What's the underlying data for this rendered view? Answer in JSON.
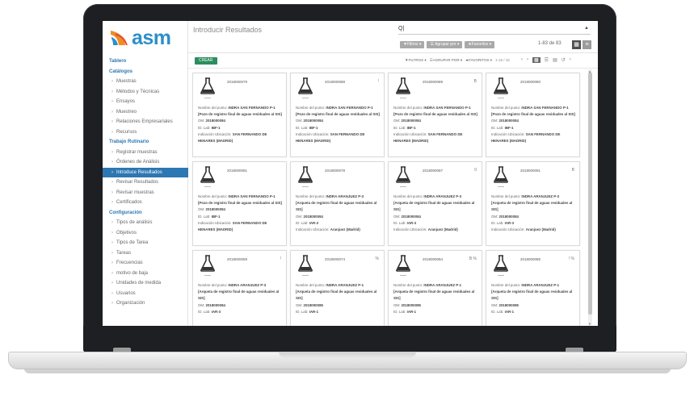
{
  "app": {
    "logo_text": "asm",
    "page_title": "Introducir Resultados",
    "brand_color": "#2d8fc8",
    "active_color": "#2d77b2",
    "create_color": "#2b8e5d"
  },
  "sidebar": {
    "items": [
      {
        "label": "Tablero",
        "type": "head"
      },
      {
        "label": "Catálogos",
        "type": "head"
      },
      {
        "label": "Muestras",
        "type": "sub"
      },
      {
        "label": "Métodos y Técnicas",
        "type": "sub"
      },
      {
        "label": "Ensayos",
        "type": "sub"
      },
      {
        "label": "Muestreo",
        "type": "sub"
      },
      {
        "label": "Relaciones Empresariales",
        "type": "sub"
      },
      {
        "label": "Recursos",
        "type": "sub"
      },
      {
        "label": "Trabajo Rutinario",
        "type": "head"
      },
      {
        "label": "Registrar muestras",
        "type": "sub"
      },
      {
        "label": "Órdenes de Análisis",
        "type": "sub"
      },
      {
        "label": "Introduce Resultados",
        "type": "active"
      },
      {
        "label": "Revisar Resultados",
        "type": "sub"
      },
      {
        "label": "Revisar muestras",
        "type": "sub"
      },
      {
        "label": "Certificados",
        "type": "sub"
      },
      {
        "label": "Configuración",
        "type": "head"
      },
      {
        "label": "Tipos de análisis",
        "type": "sub"
      },
      {
        "label": "Objetivos",
        "type": "sub"
      },
      {
        "label": "Tipos de Tarea",
        "type": "sub"
      },
      {
        "label": "Tareas",
        "type": "sub"
      },
      {
        "label": "Frecuencias",
        "type": "sub"
      },
      {
        "label": "motivo de baja",
        "type": "sub"
      },
      {
        "label": "Unidades de medida",
        "type": "sub"
      },
      {
        "label": "Usuarios",
        "type": "sub"
      },
      {
        "label": "Organización",
        "type": "sub"
      }
    ]
  },
  "topbar": {
    "search_value": "Q|",
    "filter_buttons": [
      "▼Filtros ▾",
      "☰ Agrupar por ▾",
      "★Favoritos ▾"
    ],
    "pager": "1-83 de 83"
  },
  "toolbar": {
    "create_label": "CREAR",
    "filters_label": "▼FILTROS ▾",
    "group_label": "☰AGRUPAR POR ▾",
    "fav_label": "★FAVORITOS ▾",
    "pager": "1-15 / 15"
  },
  "cards": [
    {
      "id": "2018000079",
      "mark": "",
      "punto": "INDRA SAN FERNANDO P-1",
      "pozo": "[Pozo de registro final de aguas residuales al SIS]",
      "om": "2018000084",
      "lab": "IBF-1",
      "ubicacion": "SAN FERNANDO DE HENARES (MADRID)"
    },
    {
      "id": "2018000088",
      "mark": "!",
      "punto": "INDRA SAN FERNANDO P-1",
      "pozo": "[Pozo de registro final de aguas residuales al SIS]",
      "om": "2018000084",
      "lab": "IBF-1",
      "ubicacion": "SAN FERNANDO DE HENARES (MADRID)"
    },
    {
      "id": "2018000089",
      "mark": "B",
      "punto": "INDRA SAN FERNANDO P-1",
      "pozo": "[Pozo de registro final de aguas residuales al SIS]",
      "om": "2018000084",
      "lab": "IBF-1",
      "ubicacion": "SAN FERNANDO DE HENARES (MADRID)"
    },
    {
      "id": "2018000080",
      "mark": "",
      "punto": "INDRA SAN FERNANDO P-1",
      "pozo": "[Pozo de registro final de aguas residuales al SIS]",
      "om": "2018000084",
      "lab": "IBF-1",
      "ubicacion": "SAN FERNANDO DE HENARES (MADRID)"
    },
    {
      "id": "2018000081",
      "mark": "",
      "punto": "INDRA SAN FERNANDO P-1",
      "pozo": "[Pozo de registro final de aguas residuales al SIS]",
      "om": "2018000084",
      "lab": "IBF-1",
      "ubicacion": "SAN FERNANDO DE HENARES (MADRID)"
    },
    {
      "id": "2018000078",
      "mark": "",
      "punto": "INDRA ARANJUEZ P-3",
      "pozo": "[Arqueta de registro final de aguas residuales al SIS]",
      "om": "2018000084",
      "lab": "IAR-3",
      "ubicacion": "Aranjuez (Madrid)"
    },
    {
      "id": "2018000087",
      "mark": "0",
      "punto": "INDRA ARANJUEZ P-3",
      "pozo": "[Arqueta de registro final de aguas residuales al SIS]",
      "om": "2018000084",
      "lab": "IAR-3",
      "ubicacion": "Aranjuez (Madrid)"
    },
    {
      "id": "2018000091",
      "mark": "B",
      "punto": "INDRA ARANJUEZ P-3",
      "pozo": "[Arqueta de registro final de aguas residuales al SIS]",
      "om": "2018000084",
      "lab": "IAR-3",
      "ubicacion": "Aranjuez (Madrid)"
    },
    {
      "id": "2018000059",
      "mark": "!",
      "punto": "INDRA ARANJUEZ P-3",
      "pozo": "[Arqueta de registro final de aguas residuales al SIS]",
      "om": "2018000084",
      "lab": "IAR-3",
      "ubicacion": ""
    },
    {
      "id": "2018000074",
      "mark": "%",
      "punto": "INDRA ARANJUEZ P-1",
      "pozo": "[Arqueta de registro final de aguas residuales al SIS]",
      "om": "2018000085",
      "lab": "IAR-1",
      "ubicacion": ""
    },
    {
      "id": "2018000084",
      "mark": "B %",
      "punto": "INDRA ARANJUEZ P-1",
      "pozo": "[Arqueta de registro final de aguas residuales al SIS]",
      "om": "2018000085",
      "lab": "IAR-1",
      "ubicacion": ""
    },
    {
      "id": "2018000085",
      "mark": "! %",
      "punto": "INDRA ARANJUEZ P-1",
      "pozo": "[Arqueta de registro final de aguas residuales al SIS]",
      "om": "2018000085",
      "lab": "IAR-1",
      "ubicacion": ""
    }
  ],
  "labels": {
    "punto": "Nombre del punto:",
    "om": "OM:",
    "lab": "ID. Lab:",
    "ubicacion": "Indicación Ubicación:"
  }
}
